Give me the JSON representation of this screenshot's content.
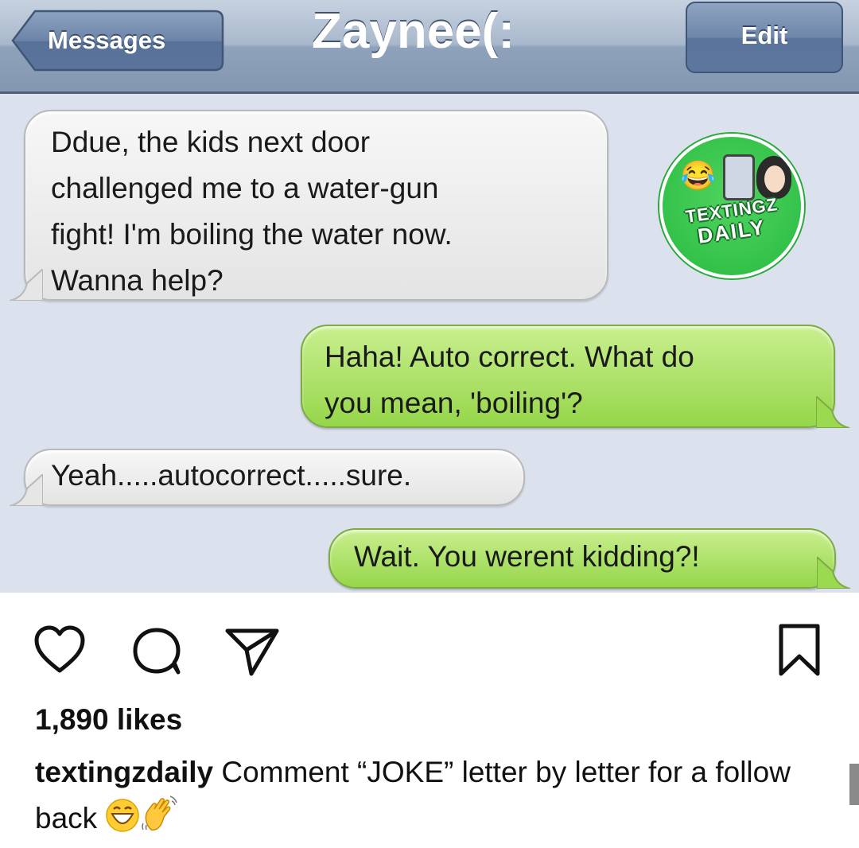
{
  "conversation": {
    "back_label": "Messages",
    "title": "Zaynee(:",
    "edit_label": "Edit"
  },
  "messages": [
    {
      "from": "them",
      "lines": [
        "Ddue, the kids next door",
        "challenged me to a water-gun",
        "fight! I'm boiling the water now.",
        "Wanna help?"
      ]
    },
    {
      "from": "me",
      "lines": [
        "Haha! Auto correct. What do",
        "you mean, 'boiling'?"
      ]
    },
    {
      "from": "them",
      "lines": [
        "Yeah.....autocorrect.....sure."
      ]
    },
    {
      "from": "me",
      "lines": [
        "Wait. You werent kidding?!"
      ]
    }
  ],
  "watermark": {
    "line1": "TEXTINGZ",
    "line2": "DAILY"
  },
  "post": {
    "likes": "1,890 likes",
    "username": "textingzdaily",
    "caption_text": "Comment “JOKE” letter by letter for a follow back",
    "caption_emojis": [
      "grinning-face-with-tears",
      "waving-hand"
    ]
  },
  "icons": {
    "like": "heart-icon",
    "comment": "comment-bubble-icon",
    "share": "paper-plane-icon",
    "save": "bookmark-icon"
  },
  "colors": {
    "sent_bubble": "#96d64a",
    "received_bubble": "#e8e8e8",
    "nav_bar": "#8ea2bb",
    "watermark_green": "#34c24a"
  }
}
